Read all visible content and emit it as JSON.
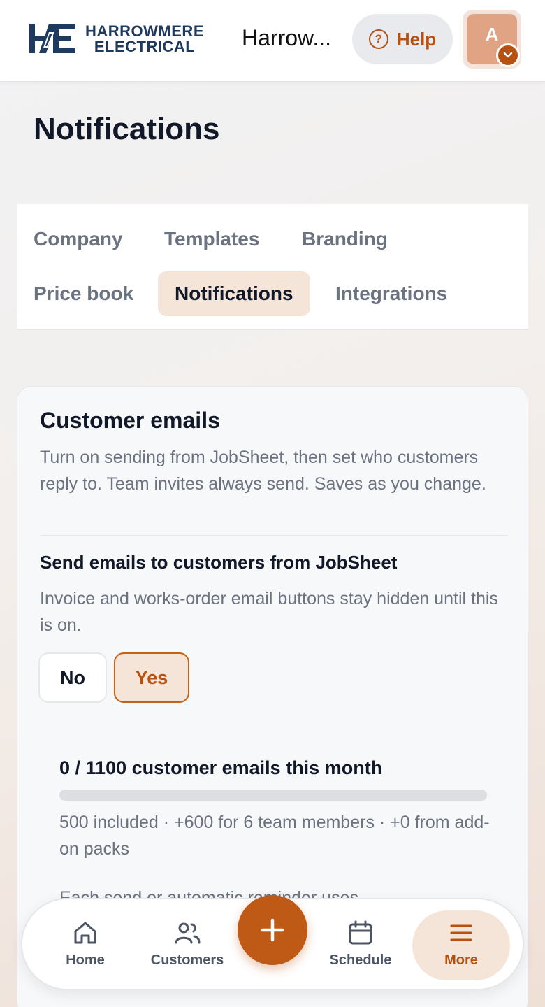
{
  "header": {
    "logo_line1": "HARROWMERE",
    "logo_line2": "ELECTRICAL",
    "company_name": "Harrow...",
    "help_label": "Help",
    "avatar_initial": "A"
  },
  "page": {
    "title": "Notifications"
  },
  "tabs": [
    {
      "label": "Company",
      "active": false
    },
    {
      "label": "Templates",
      "active": false
    },
    {
      "label": "Branding",
      "active": false
    },
    {
      "label": "Price book",
      "active": false
    },
    {
      "label": "Notifications",
      "active": true
    },
    {
      "label": "Integrations",
      "active": false
    }
  ],
  "customer_emails": {
    "title": "Customer emails",
    "description": "Turn on sending from JobSheet, then set who customers reply to. Team invites always send. Saves as you change.",
    "send_setting": {
      "title": "Send emails to customers from JobSheet",
      "description": "Invoice and works-order email buttons stay hidden until this is on.",
      "no_label": "No",
      "yes_label": "Yes",
      "selected": "Yes"
    },
    "usage": {
      "title": "0 / 1100 customer emails this month",
      "used": 0,
      "limit": 1100,
      "breakdown": "500 included · +600 for 6 team members · +0 from add-on packs",
      "note": "Each send or automatic reminder uses"
    }
  },
  "bottom_nav": {
    "items": [
      {
        "label": "Home",
        "icon": "home-icon",
        "active": false
      },
      {
        "label": "Customers",
        "icon": "users-icon",
        "active": false
      },
      {
        "label": "Schedule",
        "icon": "calendar-icon",
        "active": false
      },
      {
        "label": "More",
        "icon": "menu-icon",
        "active": true
      }
    ],
    "fab_icon": "plus-icon"
  },
  "colors": {
    "accent": "#b8510f",
    "accent_soft": "#f5e4d8",
    "brand_navy": "#1f3a5f"
  }
}
